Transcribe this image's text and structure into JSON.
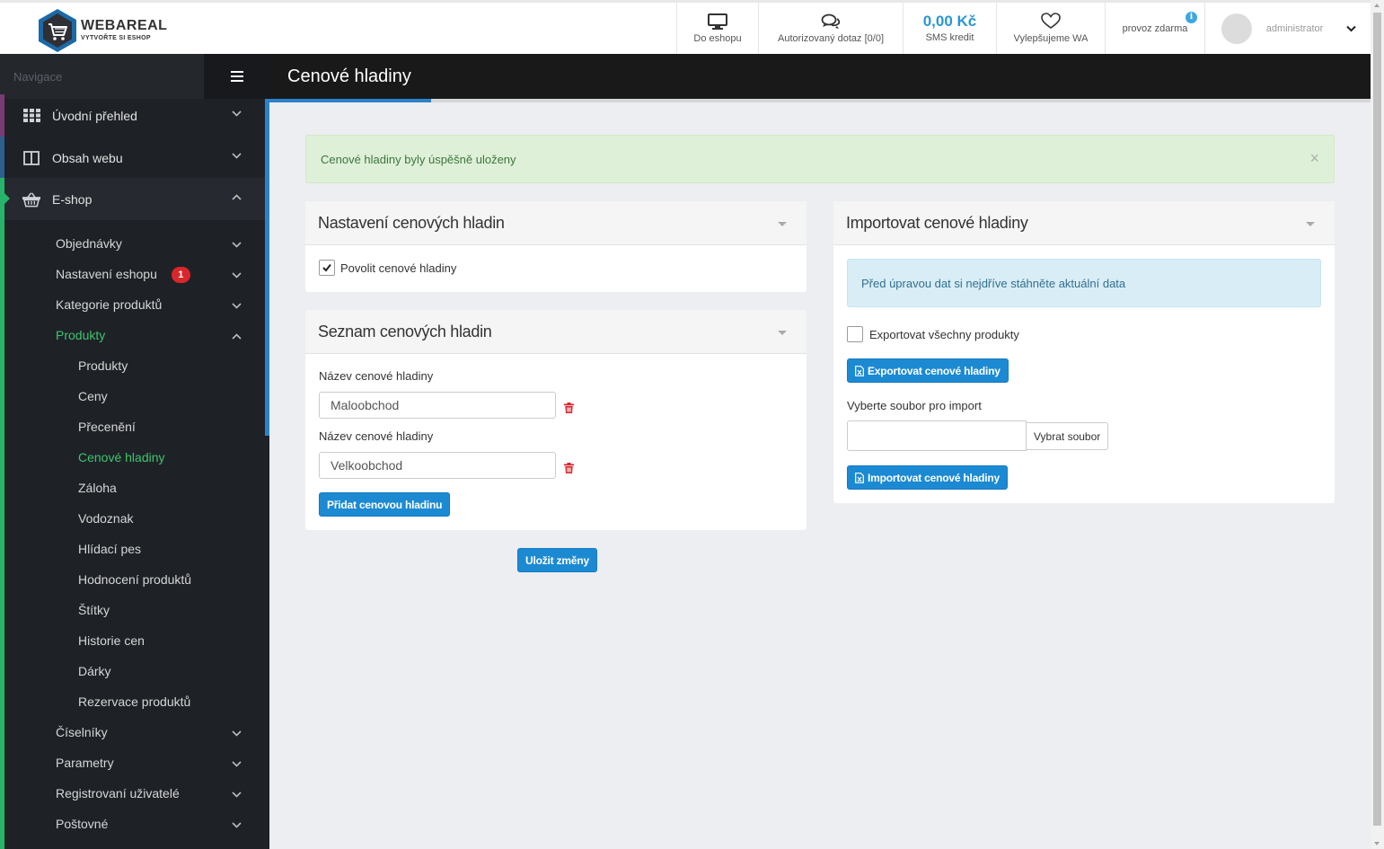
{
  "header": {
    "logo": {
      "name": "WEBAREAL",
      "tagline": "VYTVOŘTE SI ESHOP"
    },
    "items": {
      "eshop_label": "Do eshopu",
      "query_label": "Autorizovaný dotaz [0/0]",
      "credit_value": "0,00 Kč",
      "credit_label": "SMS kredit",
      "improve_label": "Vylepšujeme WA",
      "mode_label": "provoz zdarma",
      "mode_info": "i",
      "user_name": "administrator"
    },
    "accent_color": "#2996d6"
  },
  "sidebar": {
    "nav_label": "Navigace",
    "top_items": [
      {
        "label": "Úvodní přehled",
        "icon": "grid-icon",
        "bar_color": "#7a3a78"
      },
      {
        "label": "Obsah webu",
        "icon": "columns-icon",
        "bar_color": "#2d5f8f"
      },
      {
        "label": "E-shop",
        "icon": "basket-icon",
        "bar_color": "#27b36b"
      }
    ],
    "eshop_items": [
      {
        "label": "Objednávky"
      },
      {
        "label": "Nastavení eshopu",
        "badge": "1"
      },
      {
        "label": "Kategorie produktů"
      },
      {
        "label": "Produkty"
      }
    ],
    "products_sub": [
      {
        "label": "Produkty"
      },
      {
        "label": "Ceny"
      },
      {
        "label": "Přecenění"
      },
      {
        "label": "Cenové hladiny"
      },
      {
        "label": "Záloha"
      },
      {
        "label": "Vodoznak"
      },
      {
        "label": "Hlídací pes"
      },
      {
        "label": "Hodnocení produktů"
      },
      {
        "label": "Štítky"
      },
      {
        "label": "Historie cen"
      },
      {
        "label": "Dárky"
      },
      {
        "label": "Rezervace produktů"
      }
    ],
    "eshop_items_after": [
      {
        "label": "Číselníky"
      },
      {
        "label": "Parametry"
      },
      {
        "label": "Registrovaní uživatelé"
      },
      {
        "label": "Poštovné"
      }
    ],
    "active_color": "#3ec46d"
  },
  "main": {
    "page_title": "Cenové hladiny",
    "success_message": "Cenové hladiny byly úspěšně uloženy",
    "close_symbol": "×",
    "settings_panel": {
      "title": "Nastavení cenových hladin",
      "enable_label": "Povolit cenové hladiny",
      "enabled": true
    },
    "list_panel": {
      "title": "Seznam cenových hladin",
      "field_label": "Název cenové hladiny",
      "levels": [
        {
          "value": "Maloobchod"
        },
        {
          "value": "Velkoobchod"
        }
      ],
      "add_button": "Přidat cenovou hladinu"
    },
    "save_button": "Uložit změny",
    "import_panel": {
      "title": "Importovat cenové hladiny",
      "info_message": "Před úpravou dat si nejdříve stáhněte aktuální data",
      "export_all_label": "Exportovat všechny produkty",
      "export_all_checked": false,
      "export_button": "Exportovat cenové hladiny",
      "file_label": "Vyberte soubor pro import",
      "file_value": "",
      "choose_button": "Vybrat soubor",
      "import_button": "Importovat cenové hladiny"
    }
  }
}
